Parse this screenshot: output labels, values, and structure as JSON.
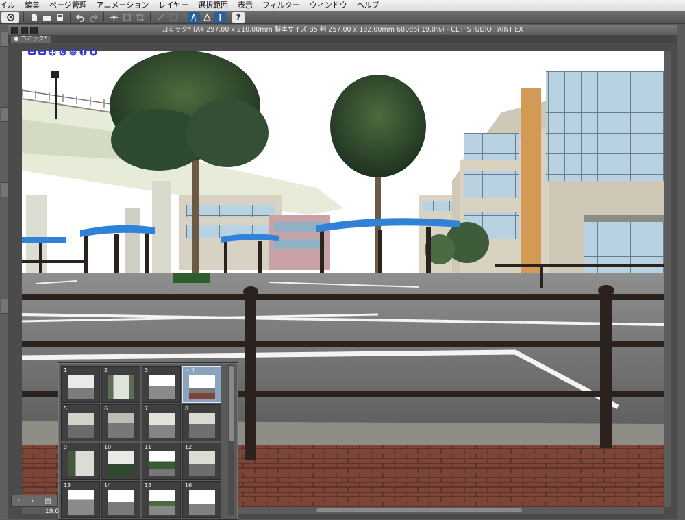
{
  "menu": {
    "items": [
      "イル",
      "編集",
      "ページ管理",
      "アニメーション",
      "レイヤー",
      "選択範囲",
      "表示",
      "フィルター",
      "ウィンドウ",
      "ヘルプ"
    ]
  },
  "toolbar": {
    "icons": [
      "clip-studio-logo-icon",
      "new-file-icon",
      "open-file-icon",
      "save-icon",
      "undo-icon",
      "redo-icon",
      "transform-icon",
      "fit-icon",
      "snap-icon",
      "ruler-snap-icon",
      "special-ruler-icon",
      "perspective-icon",
      "help-icon"
    ],
    "help_label": "?"
  },
  "document": {
    "title": "コミック* (A4 297.00 x 210.00mm 製本サイズ:B5 判 257.00 x 182.00mm 600dpi 19.0%)  - CLIP STUDIO PAINT EX",
    "tab_label": "コミック*"
  },
  "page_manager": {
    "pages": [
      {
        "num": "1",
        "checked": false
      },
      {
        "num": "2",
        "checked": false
      },
      {
        "num": "3",
        "checked": false
      },
      {
        "num": "4",
        "checked": true
      },
      {
        "num": "5",
        "checked": false
      },
      {
        "num": "6",
        "checked": false
      },
      {
        "num": "7",
        "checked": false
      },
      {
        "num": "8",
        "checked": false
      },
      {
        "num": "9",
        "checked": false
      },
      {
        "num": "10",
        "checked": false
      },
      {
        "num": "11",
        "checked": false
      },
      {
        "num": "12",
        "checked": false
      },
      {
        "num": "13",
        "checked": false
      },
      {
        "num": "14",
        "checked": false
      },
      {
        "num": "15",
        "checked": false
      },
      {
        "num": "16",
        "checked": false
      }
    ],
    "selected_marker": "✓",
    "zoom_label": "19.0",
    "nav_prev": "‹",
    "nav_next": "›"
  },
  "colors": {
    "menu_bg": "#e6e6e6",
    "toolbar_bg": "#5e5e5e",
    "shelter_roof_blue": "#2f82d8",
    "railing_brown": "#2b211d",
    "brick_red": "#7a3f34",
    "sky": "#ffffff"
  }
}
